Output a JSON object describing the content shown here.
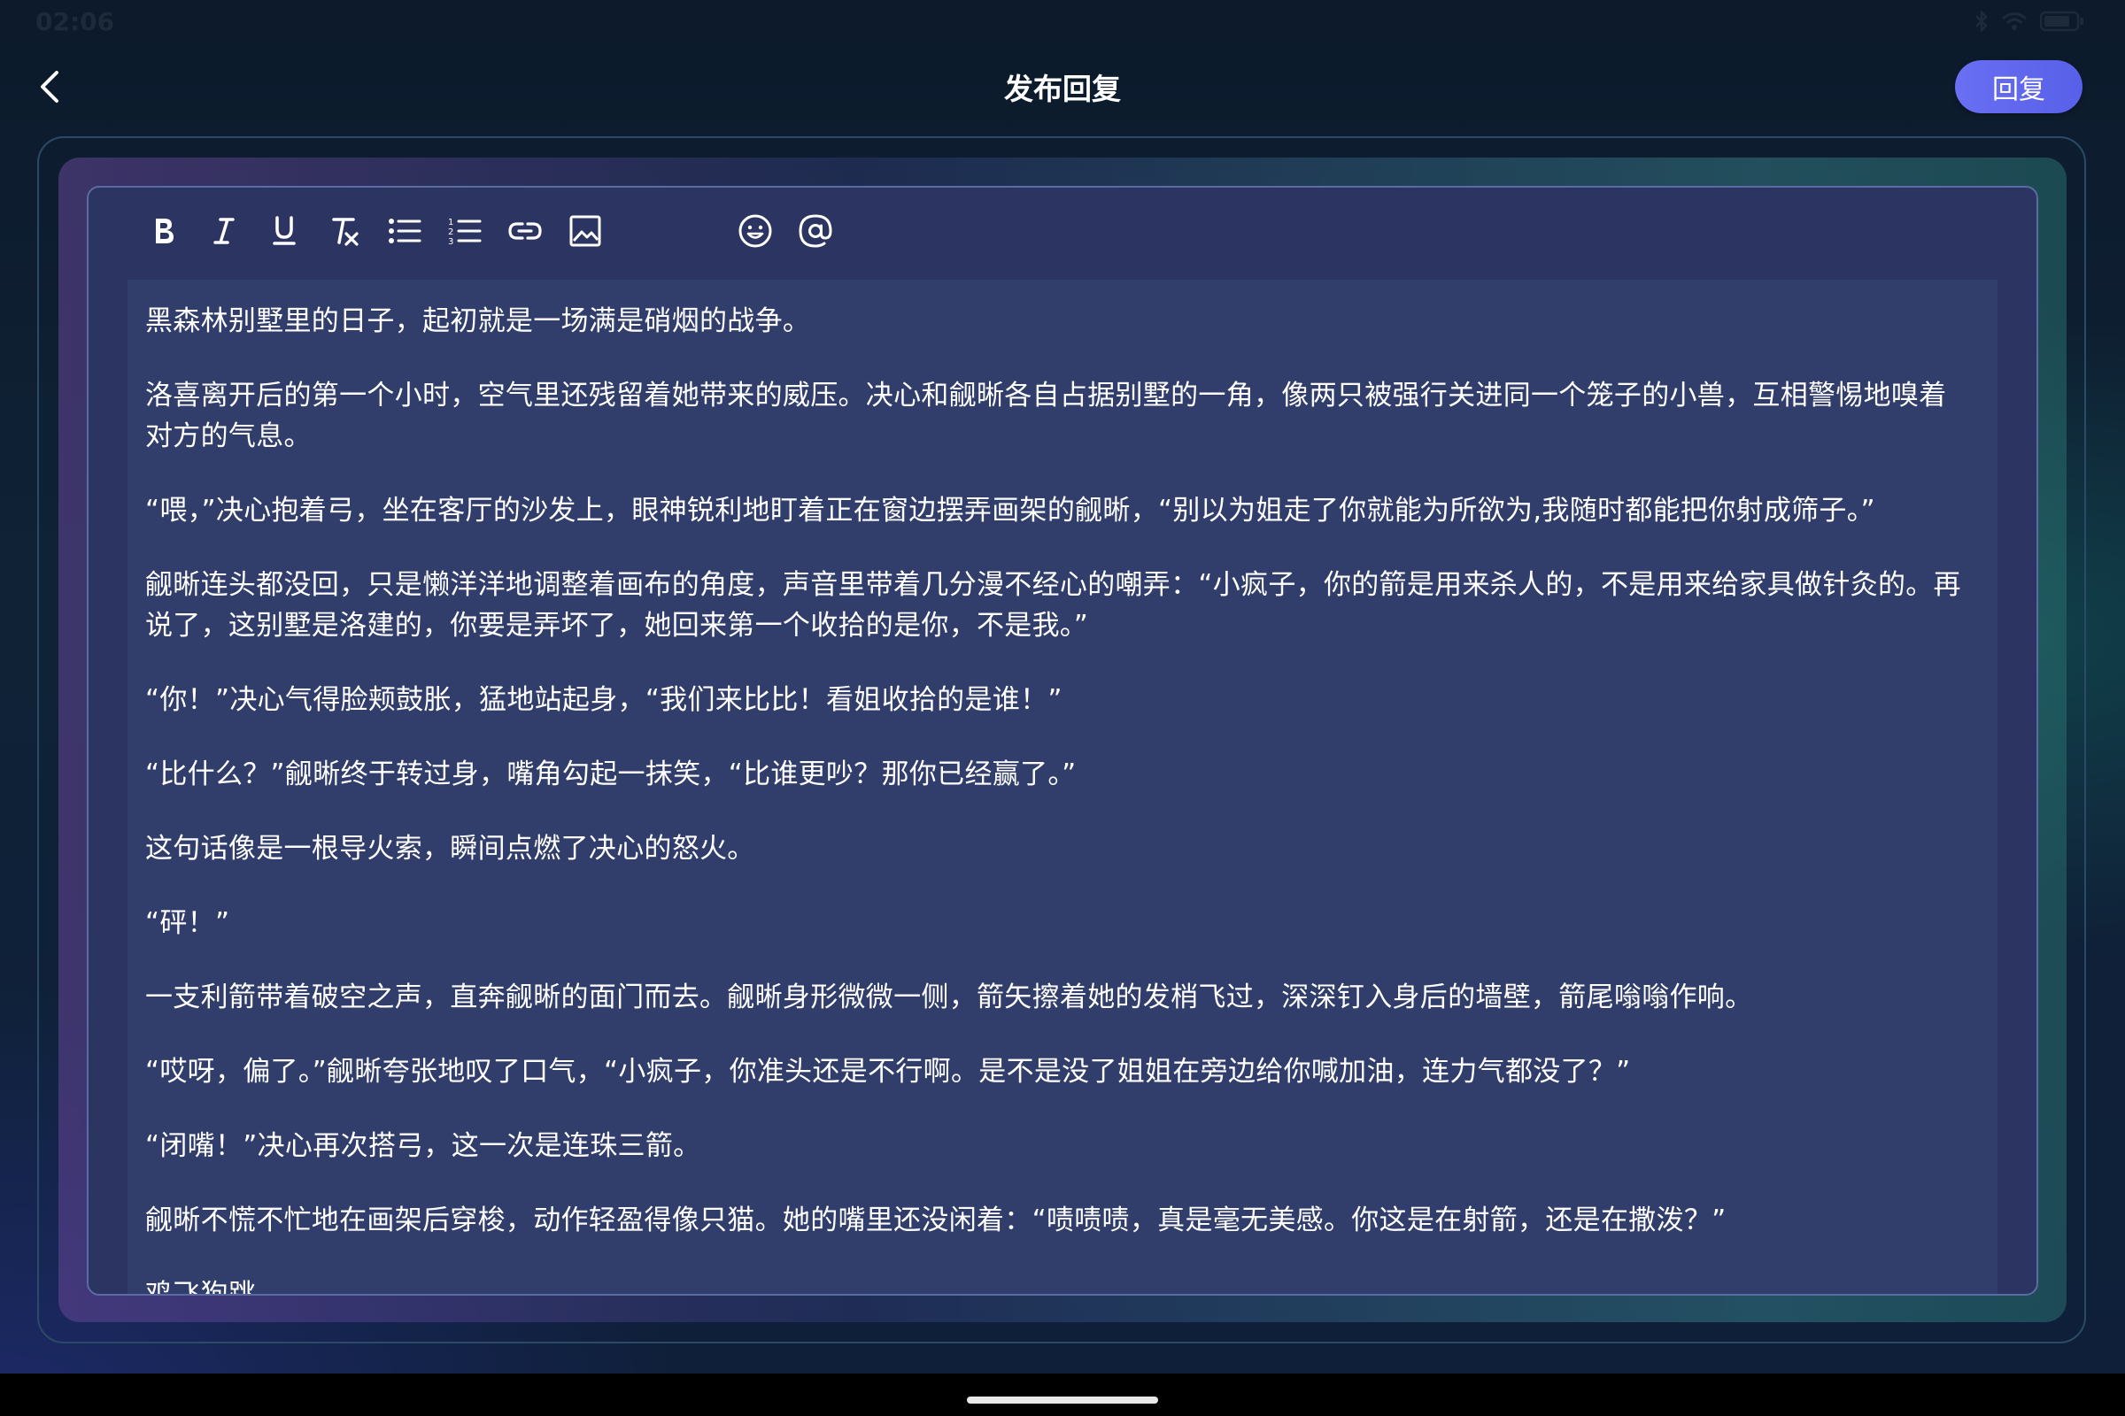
{
  "status_bar": {
    "time": "02:06",
    "icons": [
      "bluetooth-icon",
      "wifi-icon",
      "battery-icon"
    ]
  },
  "header": {
    "title": "发布回复",
    "back_icon": "chevron-left-icon",
    "reply_label": "回复"
  },
  "toolbar": {
    "tools": [
      "bold-icon",
      "italic-icon",
      "underline-icon",
      "clear-format-icon",
      "bullet-list-icon",
      "numbered-list-icon",
      "link-icon",
      "image-icon",
      "emoji-icon",
      "mention-icon"
    ]
  },
  "editor": {
    "paragraphs": [
      "黑森林别墅里的日子，起初就是一场满是硝烟的战争。",
      "洛喜离开后的第一个小时，空气里还残留着她带来的威压。决心和觎晰各自占据别墅的一角，像两只被强行关进同一个笼子的小兽，互相警惕地嗅着对方的气息。",
      "“喂，”决心抱着弓，坐在客厅的沙发上，眼神锐利地盯着正在窗边摆弄画架的觎晰，“别以为姐走了你就能为所欲为,我随时都能把你射成筛子。”",
      "觎晰连头都没回，只是懒洋洋地调整着画布的角度，声音里带着几分漫不经心的嘲弄：“小疯子，你的箭是用来杀人的，不是用来给家具做针灸的。再说了，这别墅是洛建的，你要是弄坏了，她回来第一个收拾的是你，不是我。”",
      "“你！”决心气得脸颊鼓胀，猛地站起身，“我们来比比！看姐收拾的是谁！”",
      "“比什么？”觎晰终于转过身，嘴角勾起一抹笑，“比谁更吵？那你已经赢了。”",
      "这句话像是一根导火索，瞬间点燃了决心的怒火。",
      "“砰！”",
      "一支利箭带着破空之声，直奔觎晰的面门而去。觎晰身形微微一侧，箭矢擦着她的发梢飞过，深深钉入身后的墙壁，箭尾嗡嗡作响。",
      "“哎呀，偏了。”觎晰夸张地叹了口气，“小疯子，你准头还是不行啊。是不是没了姐姐在旁边给你喊加油，连力气都没了？”",
      "“闭嘴！”决心再次搭弓，这一次是连珠三箭。",
      "觎晰不慌不忙地在画架后穿梭，动作轻盈得像只猫。她的嘴里还没闲着：“啧啧啧，真是毫无美感。你这是在射箭，还是在撒泼？”",
      "鸡飞狗跳。"
    ]
  }
}
